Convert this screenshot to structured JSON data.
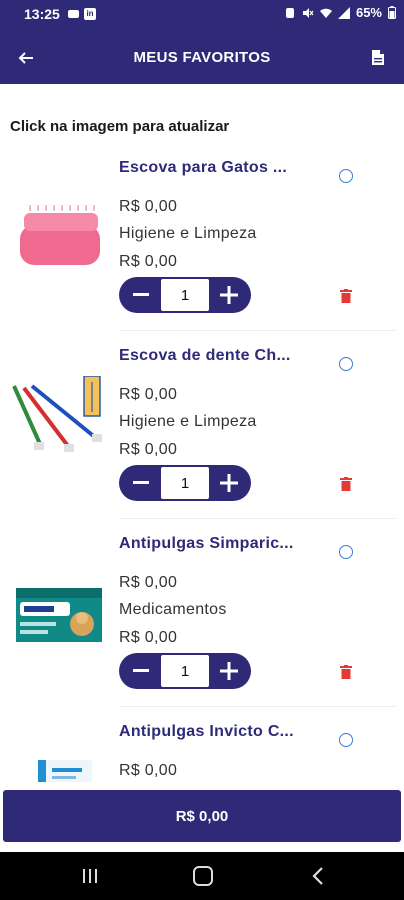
{
  "status": {
    "time": "13:25",
    "battery": "65%"
  },
  "header": {
    "title": "MEUS FAVORITOS"
  },
  "hint": "Click na imagem para atualizar",
  "items": [
    {
      "name": "Escova para Gatos ...",
      "price": "R$ 0,00",
      "category": "Higiene e Limpeza",
      "total": "R$ 0,00",
      "qty": "1",
      "image": "pink-cat-brush"
    },
    {
      "name": "Escova de dente Ch...",
      "price": "R$ 0,00",
      "category": "Higiene e Limpeza",
      "total": "R$ 0,00",
      "qty": "1",
      "image": "toothbrushes"
    },
    {
      "name": "Antipulgas Simparic...",
      "price": "R$ 0,00",
      "category": "Medicamentos",
      "total": "R$ 0,00",
      "qty": "1",
      "image": "simparic-box"
    },
    {
      "name": "Antipulgas Invicto C...",
      "price": "R$ 0,00",
      "image": "invicto-box"
    }
  ],
  "footer": {
    "total": "R$ 0,00"
  },
  "colors": {
    "primary": "#2e2a78",
    "radio": "#3b7bd6",
    "trash": "#e53935"
  }
}
